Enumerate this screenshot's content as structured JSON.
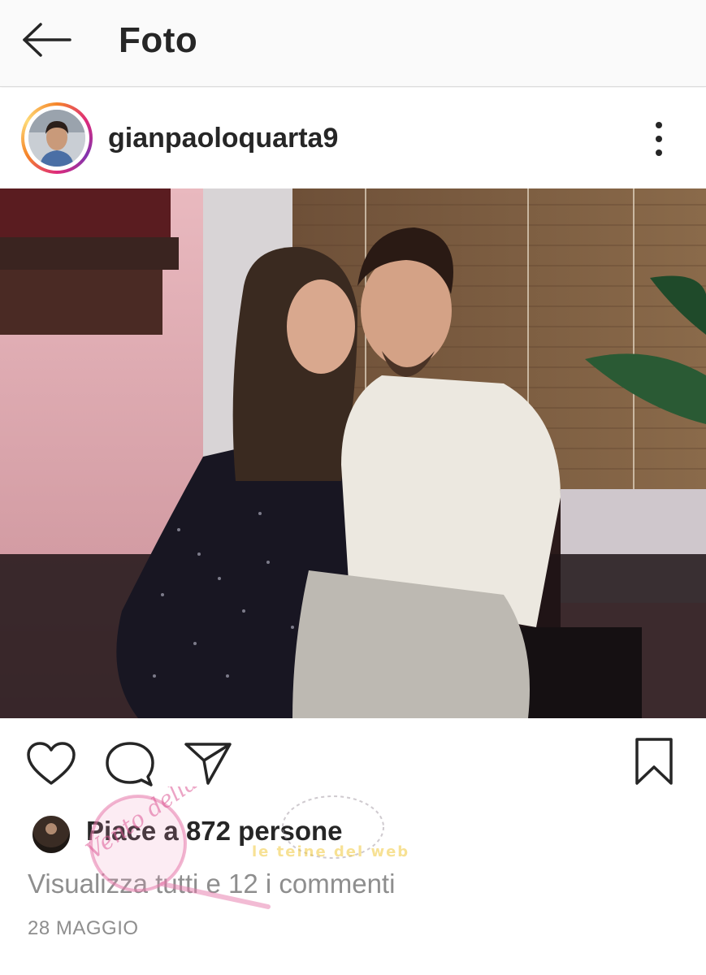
{
  "header": {
    "title": "Foto",
    "back_icon": "arrow-left-icon"
  },
  "post": {
    "username": "gianpaoloquarta9",
    "more_icon": "more-vertical-icon",
    "likes": {
      "prefix": "Piace a ",
      "count_text": "872 persone"
    },
    "comments_link": "Visualizza tutti e 12 i commenti",
    "date": "28 MAGGIO"
  },
  "actions": {
    "like_icon": "heart-icon",
    "comment_icon": "comment-icon",
    "share_icon": "send-icon",
    "save_icon": "bookmark-icon"
  },
  "watermark": {
    "text_main": "Vento della Novus",
    "text_sub": "le teine del web"
  },
  "colors": {
    "story_ring": [
      "#f58529",
      "#dd2a7b",
      "#8134af"
    ],
    "text_primary": "#262626",
    "text_secondary": "#8e8e8e"
  }
}
